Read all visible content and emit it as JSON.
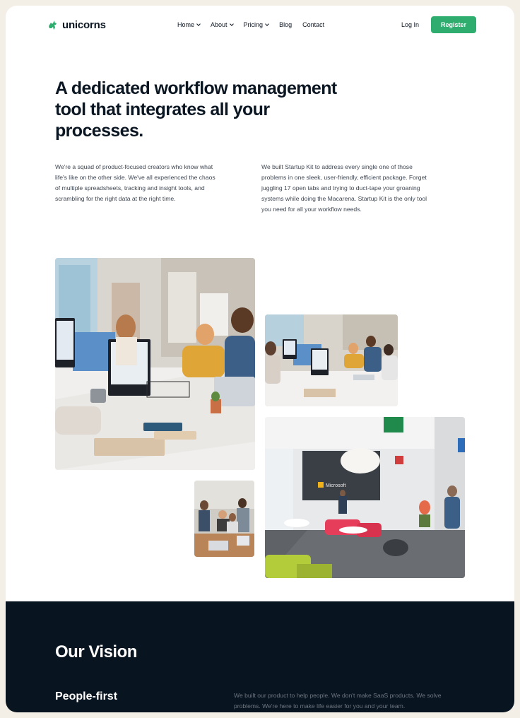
{
  "brand": {
    "name": "unicorns",
    "accent_color": "#2ead6e",
    "logo_icon": "unicorn-icon"
  },
  "nav": {
    "items": [
      {
        "label": "Home",
        "has_dropdown": true
      },
      {
        "label": "About",
        "has_dropdown": true
      },
      {
        "label": "Pricing",
        "has_dropdown": true
      },
      {
        "label": "Blog",
        "has_dropdown": false
      },
      {
        "label": "Contact",
        "has_dropdown": false
      }
    ],
    "login_label": "Log In",
    "register_label": "Register"
  },
  "hero": {
    "title": "A dedicated workflow management tool that integrates all your processes.",
    "paragraph_1": "We're a squad of product-focused creators who know what life's like on the other side. We've all experienced the chaos of multiple spreadsheets, tracking and insight tools, and scrambling for the right data at the right time.",
    "paragraph_2": "We built Startup Kit to address every single one of those problems in one sleek, user-friendly, efficient package. Forget juggling 17 open tabs and trying to duct-tape your groaning systems while doing the Macarena. Startup Kit is the only tool you need for all your workflow needs."
  },
  "gallery": {
    "photos": [
      {
        "name": "team-working-photo"
      },
      {
        "name": "open-office-desks-photo"
      },
      {
        "name": "team-meeting-photo"
      },
      {
        "name": "office-lobby-photo",
        "sign_text": "Microsoft"
      }
    ]
  },
  "vision": {
    "background_color": "#08141f",
    "title": "Our Vision",
    "subtitle": "People-first",
    "text": "We built our product to help people. We don't make SaaS products. We solve problems. We're here to make life easier for you and your team."
  }
}
